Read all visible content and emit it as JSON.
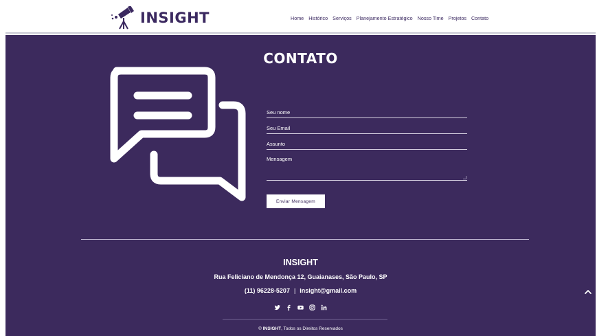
{
  "brand": {
    "name": "INSIGHT",
    "icon": "telescope-icon"
  },
  "nav": {
    "items": [
      "Home",
      "Histórico",
      "Serviços",
      "Planejamento Estratégico",
      "Nosso Time",
      "Projetos",
      "Contato"
    ]
  },
  "contact": {
    "title": "CONTATO",
    "illustration": "chat-bubbles-icon",
    "form": {
      "name_label": "Seu nome",
      "email_label": "Seu Email",
      "subject_label": "Assunto",
      "message_label": "Mensagem",
      "submit_label": "Enviar Mensagem"
    }
  },
  "footer": {
    "title": "INSIGHT",
    "address": "Rua Feliciano de Mendonça 12, Guaianases, São Paulo, SP",
    "phone": "(11) 96228-5207",
    "separator": "|",
    "email": "insight@gmail.com",
    "social": [
      "twitter-icon",
      "facebook-icon",
      "youtube-icon",
      "instagram-icon",
      "linkedin-icon"
    ],
    "copyright_brand": "INSIGHT",
    "copyright_prefix": "©",
    "copyright_text": ", Todos os Direitos Reservados"
  },
  "colors": {
    "primary": "#3c2a5d",
    "text_light": "#ffffff",
    "divider": "#bdb4cf"
  }
}
